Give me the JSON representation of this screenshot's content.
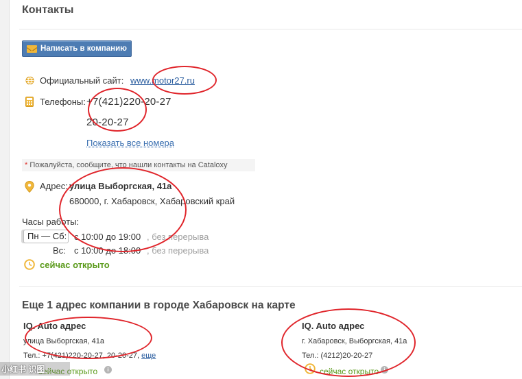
{
  "header": {
    "title": "Контакты"
  },
  "write_button": {
    "label": "Написать в компанию"
  },
  "website": {
    "label": "Официальный сайт:",
    "url": "www.motor27.ru"
  },
  "phones": {
    "label": "Телефоны:",
    "items": [
      "+7(421)220-20-27",
      "20-20-27"
    ],
    "show_all": "Показать все номера"
  },
  "notice": {
    "star": "*",
    "text": "Пожалуйста, сообщите, что нашли контакты на Cataloxy"
  },
  "address": {
    "label": "Адрес:",
    "street": "улица Выборгская, 41а",
    "city": "680000, г. Хабаровск, Хабаровский край"
  },
  "hours": {
    "title": "Часы работы:",
    "rows": [
      {
        "days": "Пн — Сб:",
        "time": "с 10:00 до 19:00",
        "note": ", без перерыва"
      },
      {
        "days": "Вс:",
        "time": "с 10:00 до 18:00",
        "note": ", без перерыва"
      }
    ],
    "open_now": "сейчас открыто"
  },
  "more": {
    "title": "Еще 1 адрес компании в городе Хабаровск на карте",
    "cards": [
      {
        "title": "IQ. Auto адрес",
        "address": "улица Выборгская, 41а",
        "phone_label": "Тел.:",
        "phones": "+7(421)220-20-27, 20-20-27,",
        "more_link": "еще",
        "status": "сейчас открыто"
      },
      {
        "title": "IQ. Auto адрес",
        "address": "г. Хабаровск, Выборгская, 41а",
        "phone_label": "Тел.:",
        "phones": "(4212)20-20-27",
        "status": "сейчас открыто"
      }
    ]
  },
  "watermark": {
    "text": "小红书 识图"
  },
  "colors": {
    "accent": "#4d7cb3",
    "link": "#2a5d9f",
    "open": "#5a9a1a",
    "annotation": "#e0252b",
    "icon": "#f0b73a"
  },
  "icons": [
    "globe-icon",
    "calculator-icon",
    "location-pin-icon",
    "clock-icon",
    "envelope-icon",
    "info-icon"
  ]
}
